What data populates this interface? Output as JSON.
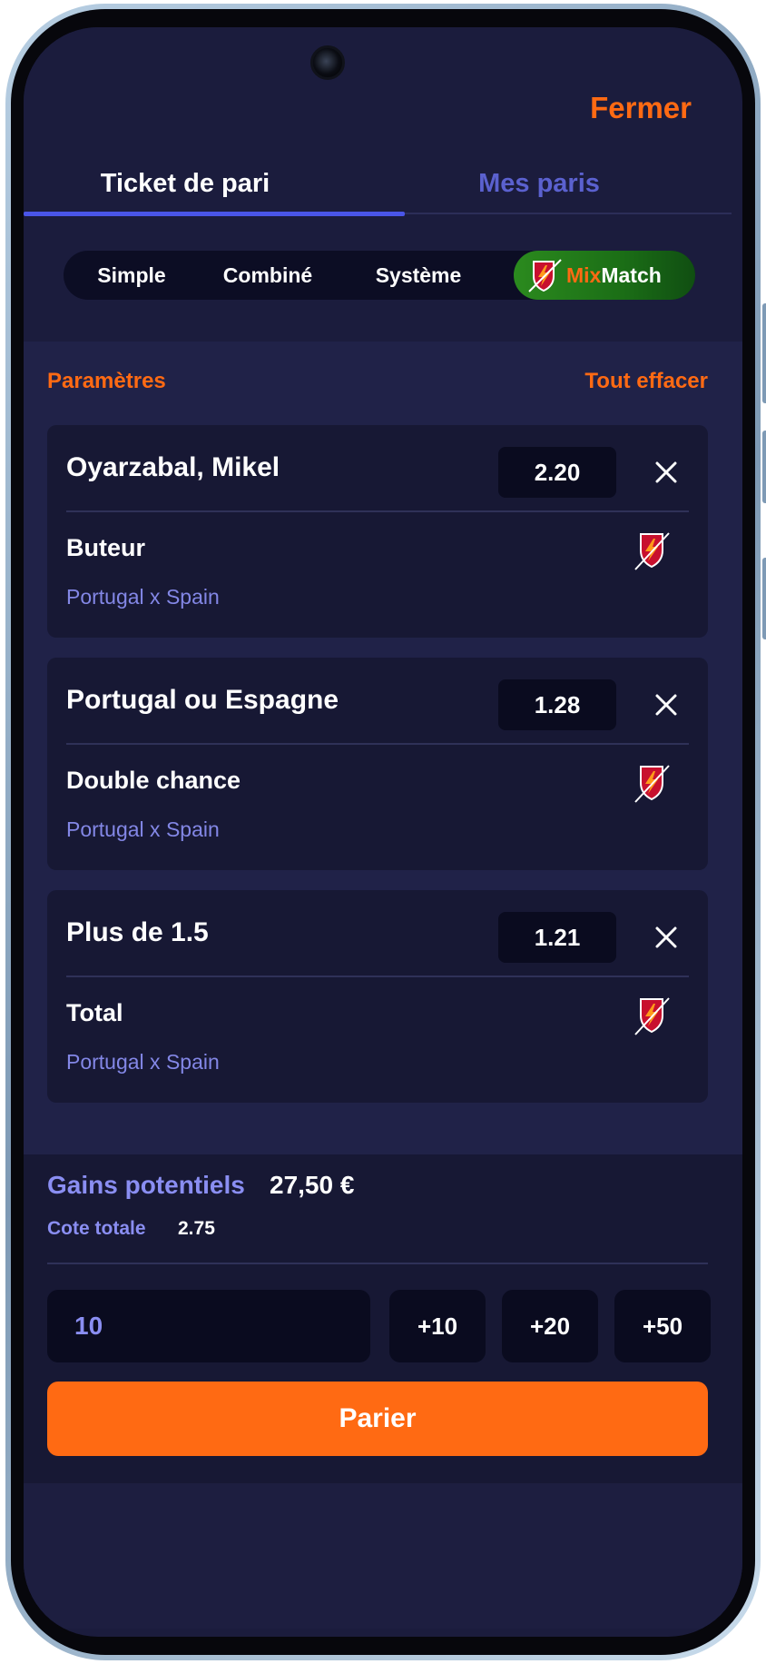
{
  "header": {
    "close_label": "Fermer",
    "tabs": [
      {
        "label": "Ticket de pari",
        "active": true
      },
      {
        "label": "Mes paris",
        "active": false
      }
    ],
    "bet_types": [
      "Simple",
      "Combiné",
      "Système"
    ],
    "mixmatch": {
      "part1": "Mix",
      "part2": "Match",
      "active": true
    }
  },
  "actions": {
    "settings_label": "Paramètres",
    "clear_all_label": "Tout effacer"
  },
  "bets": [
    {
      "selection": "Oyarzabal, Mikel",
      "odds": "2.20",
      "market": "Buteur",
      "match": "Portugal x Spain",
      "icon": "mixmatch-shield-icon"
    },
    {
      "selection": "Portugal ou Espagne",
      "odds": "1.28",
      "market": "Double chance",
      "match": "Portugal x Spain",
      "icon": "mixmatch-shield-icon"
    },
    {
      "selection": "Plus de 1.5",
      "odds": "1.21",
      "market": "Total",
      "match": "Portugal x Spain",
      "icon": "mixmatch-shield-icon"
    }
  ],
  "summary": {
    "potential_gains_label": "Gains potentiels",
    "potential_gains_value": "27,50 €",
    "total_odds_label": "Cote totale",
    "total_odds_value": "2.75"
  },
  "stake": {
    "value": "10",
    "quick_amounts": [
      "+10",
      "+20",
      "+50"
    ]
  },
  "place_bet_label": "Parier",
  "colors": {
    "accent": "#ff6a13",
    "tab_indicator": "#4a55e8",
    "muted_text": "#8a8ef2",
    "background": "#202248",
    "card": "#171834",
    "mixmatch_green": "#2b8a1e"
  }
}
